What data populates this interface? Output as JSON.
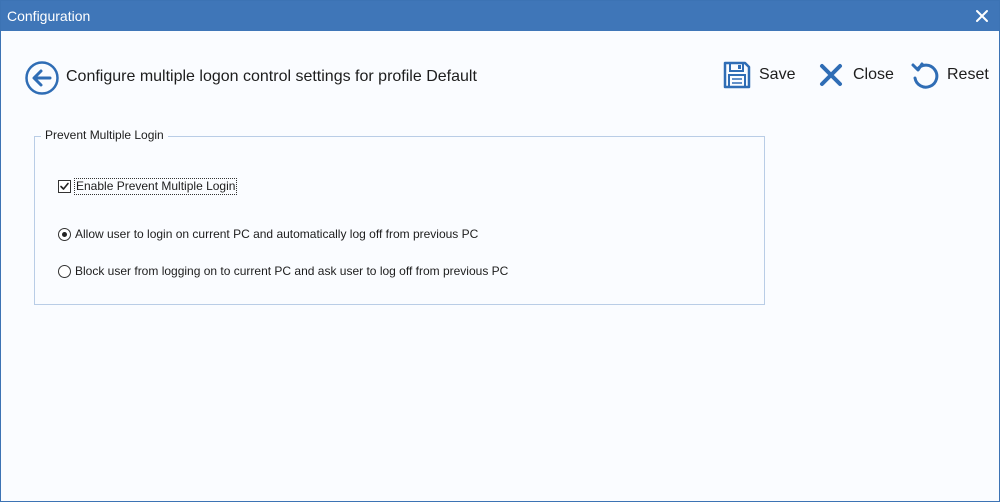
{
  "window": {
    "title": "Configuration"
  },
  "header": {
    "title": "Configure multiple logon control settings for profile Default"
  },
  "toolbar": {
    "save_label": "Save",
    "close_label": "Close",
    "reset_label": "Reset"
  },
  "group": {
    "legend": "Prevent Multiple Login",
    "checkbox": {
      "label": "Enable Prevent Multiple Login",
      "checked": true
    },
    "options": [
      {
        "label": "Allow user to login on current PC and automatically log off from previous PC",
        "selected": true
      },
      {
        "label": "Block user from logging on to current PC and ask user to log off from previous PC",
        "selected": false
      }
    ]
  },
  "colors": {
    "titlebar": "#3f76b8",
    "accent": "#2f6db5",
    "group_border": "#b9cde6"
  },
  "icons": {
    "back": "arrow-left-circle-icon",
    "save": "floppy-disk-icon",
    "close": "x-icon",
    "reset": "undo-arrow-icon",
    "window_close": "close-icon"
  }
}
